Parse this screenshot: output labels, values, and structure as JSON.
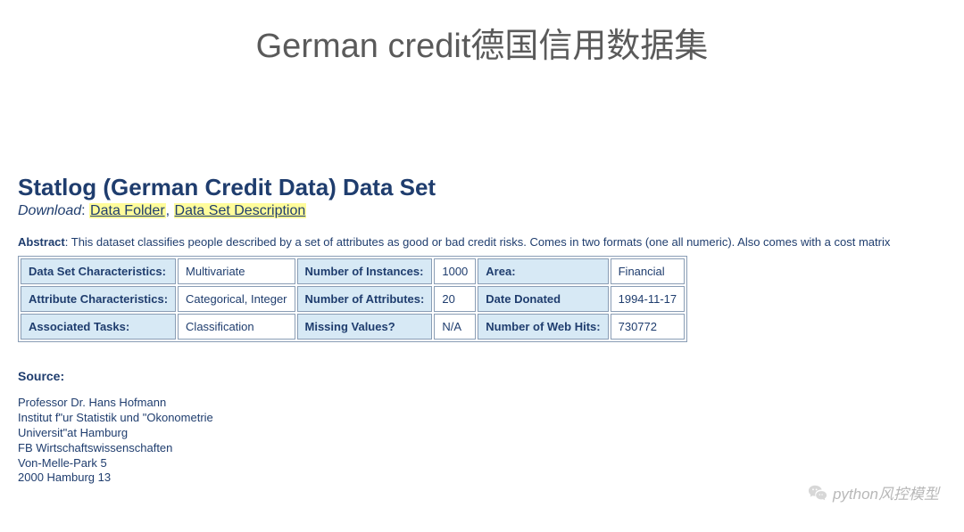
{
  "slide_title": "German credit德国信用数据集",
  "dataset_heading": "Statlog (German Credit Data) Data Set",
  "download": {
    "label": "Download",
    "link1": "Data Folder",
    "separator": ", ",
    "link2": "Data Set Description"
  },
  "abstract": {
    "label": "Abstract",
    "text": "This dataset classifies people described by a set of attributes as good or bad credit risks. Comes in two formats (one all numeric). Also comes with a cost matrix"
  },
  "table": {
    "rows": [
      {
        "l1": "Data Set Characteristics:  ",
        "v1": "Multivariate",
        "l2": "Number of Instances:",
        "v2": "1000",
        "l3": "Area:",
        "v3": "Financial"
      },
      {
        "l1": "Attribute Characteristics:",
        "v1": "Categorical, Integer",
        "l2": "Number of Attributes:",
        "v2": "20",
        "l3": "Date Donated",
        "v3": "1994-11-17"
      },
      {
        "l1": "Associated Tasks:",
        "v1": "Classification",
        "l2": "Missing Values?",
        "v2": "N/A",
        "l3": "Number of Web Hits:",
        "v3": "730772"
      }
    ]
  },
  "source": {
    "heading": "Source:",
    "lines": [
      "Professor Dr. Hans Hofmann",
      "Institut f\"ur Statistik und \"Okonometrie",
      "Universit\"at Hamburg",
      "FB Wirtschaftswissenschaften",
      "Von-Melle-Park 5",
      "2000 Hamburg 13"
    ]
  },
  "watermark": "python风控模型"
}
